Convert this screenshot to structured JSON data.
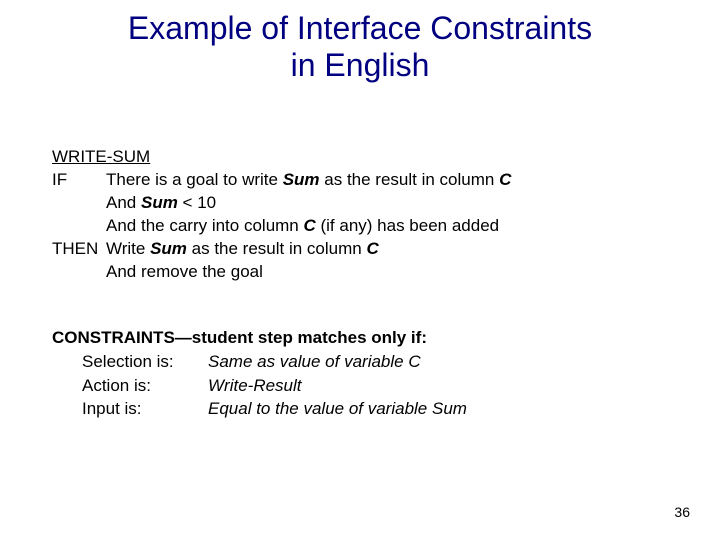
{
  "title_line1": "Example of Interface Constraints",
  "title_line2": "in English",
  "rule_name": "WRITE-SUM",
  "if_kw": "IF",
  "then_kw": "THEN",
  "if_l1_a": "There is a goal to write ",
  "if_l1_sum": "Sum",
  "if_l1_b": " as the result in column ",
  "if_l1_C": "C",
  "if_l2_a": "And ",
  "if_l2_sum": "Sum",
  "if_l2_b": " < 10",
  "if_l3_a": "And the carry into column ",
  "if_l3_C": "C",
  "if_l3_b": " (if any) has been added",
  "then_l1_a": "Write ",
  "then_l1_sum": "Sum",
  "then_l1_b": " as the result in column ",
  "then_l1_C": "C",
  "then_l2": "And remove the goal",
  "constraints_header": "CONSTRAINTS—student step matches only if:",
  "c1_label": "Selection is:",
  "c1_value": "Same as value of variable C",
  "c2_label": "Action is:",
  "c2_value": "Write-Result",
  "c3_label": "Input is:",
  "c3_value": "Equal to the value of variable Sum",
  "page_number": "36"
}
